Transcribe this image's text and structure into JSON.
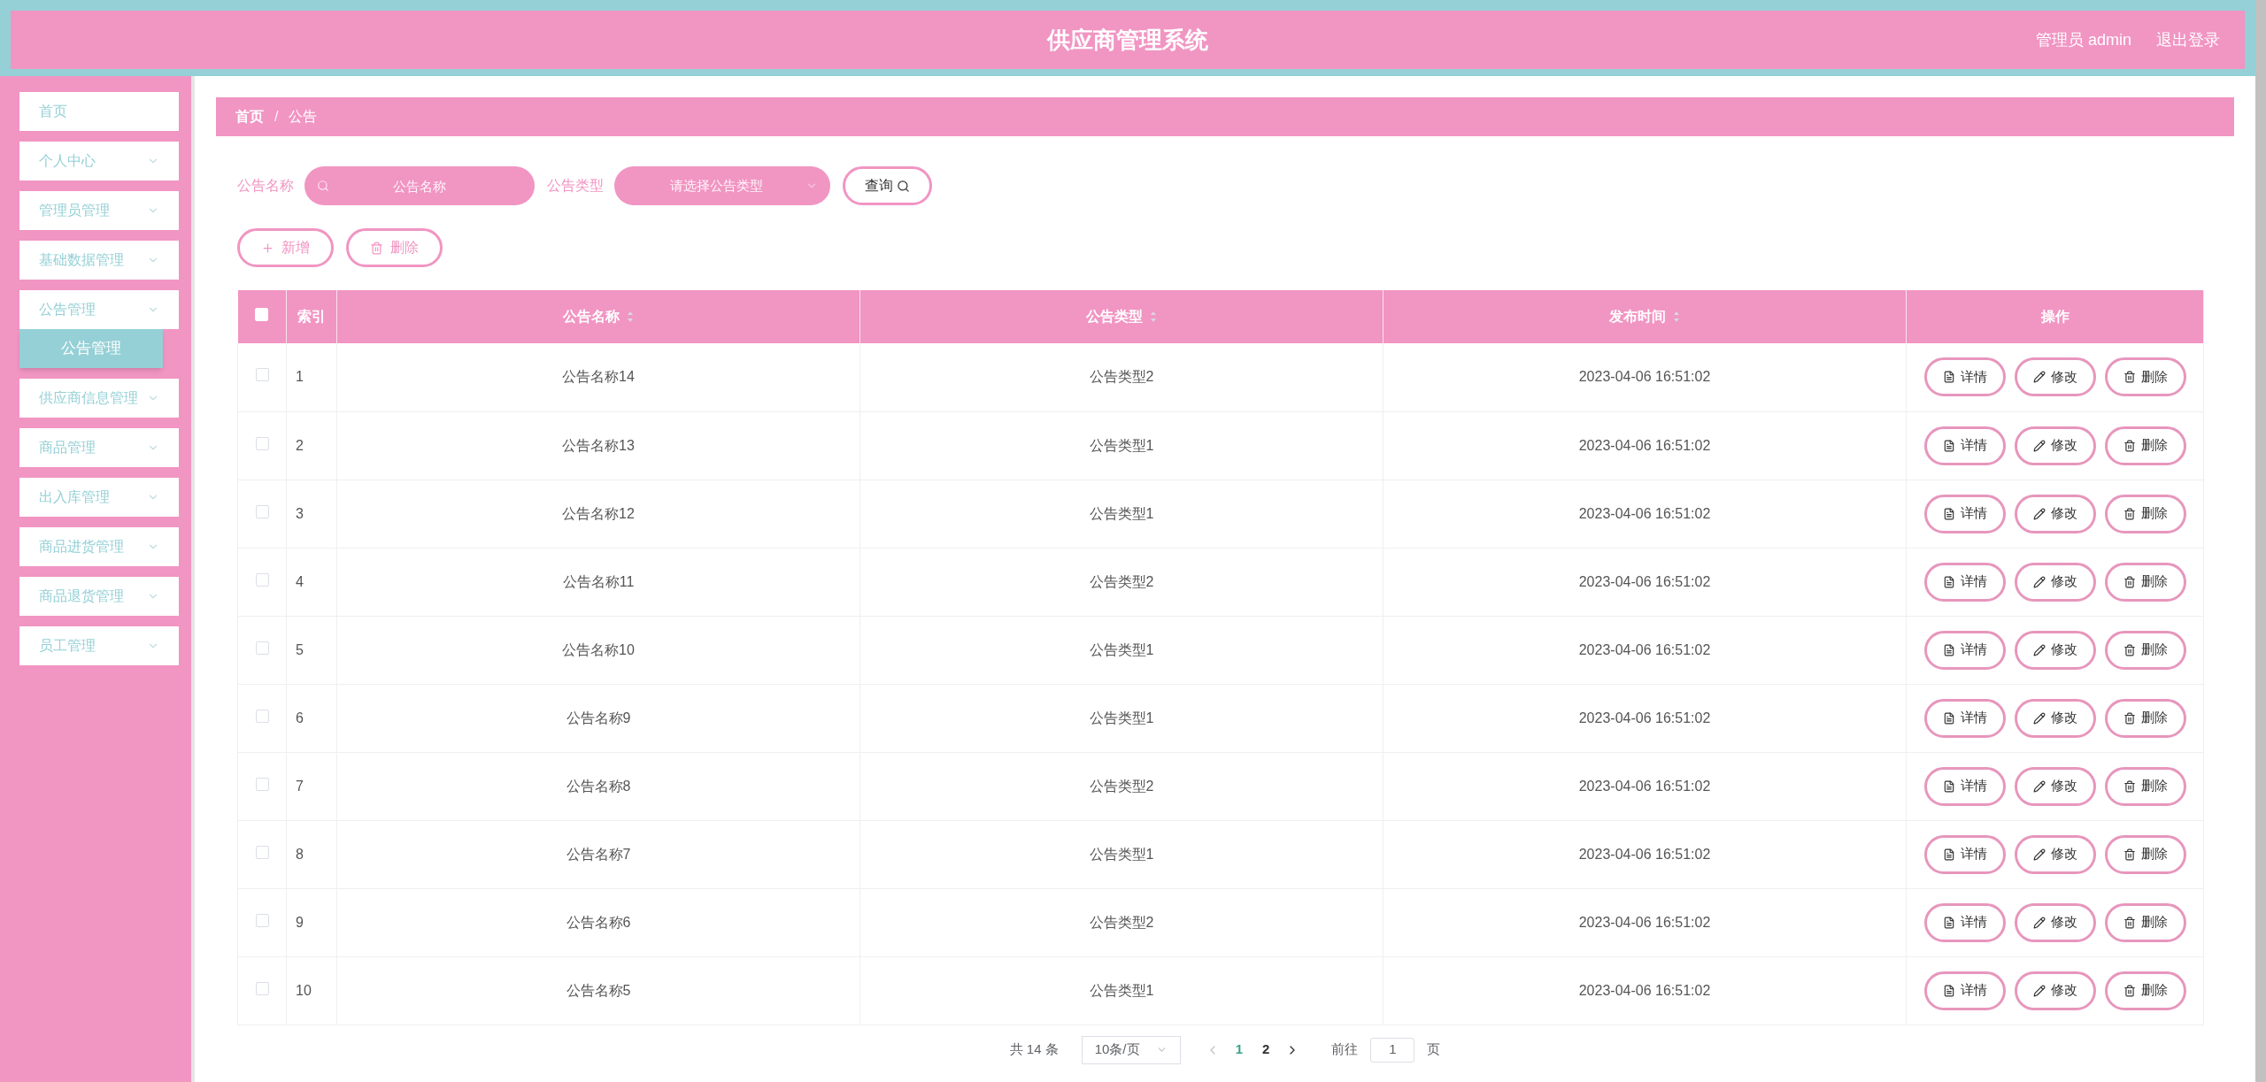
{
  "header": {
    "title": "供应商管理系统",
    "user": "管理员 admin",
    "logout": "退出登录"
  },
  "sidebar": {
    "items": [
      {
        "label": "首页",
        "has_arrow": false
      },
      {
        "label": "个人中心",
        "has_arrow": true
      },
      {
        "label": "管理员管理",
        "has_arrow": true
      },
      {
        "label": "基础数据管理",
        "has_arrow": true
      },
      {
        "label": "公告管理",
        "has_arrow": true,
        "children": [
          {
            "label": "公告管理",
            "selected": true
          }
        ]
      },
      {
        "label": "供应商信息管理",
        "has_arrow": true
      },
      {
        "label": "商品管理",
        "has_arrow": true
      },
      {
        "label": "出入库管理",
        "has_arrow": true
      },
      {
        "label": "商品进货管理",
        "has_arrow": true
      },
      {
        "label": "商品退货管理",
        "has_arrow": true
      },
      {
        "label": "员工管理",
        "has_arrow": true
      }
    ]
  },
  "breadcrumb": [
    {
      "label": "首页"
    },
    {
      "separator": "/",
      "label": "公告"
    }
  ],
  "search": {
    "name_label": "公告名称",
    "name_placeholder": "公告名称",
    "type_label": "公告类型",
    "type_placeholder": "请选择公告类型",
    "query_button": "查询"
  },
  "actions": [
    {
      "kind": "add",
      "label": "新增"
    },
    {
      "kind": "delete",
      "label": "删除"
    }
  ],
  "table": {
    "select_all_checked": false,
    "columns": [
      {
        "label": "索引",
        "sortable": false
      },
      {
        "label": "公告名称",
        "sortable": true
      },
      {
        "label": "公告类型",
        "sortable": true
      },
      {
        "label": "发布时间",
        "sortable": true
      },
      {
        "label": "操作",
        "sortable": false
      }
    ],
    "rows": [
      {
        "checked": false,
        "cells": [
          "1",
          "公告名称14",
          "公告类型2",
          "2023-04-06 16:51:02"
        ],
        "buttons": [
          {
            "kind": "detail",
            "label": "详情"
          },
          {
            "kind": "edit",
            "label": "修改"
          },
          {
            "kind": "delete",
            "label": "删除"
          }
        ]
      },
      {
        "checked": false,
        "cells": [
          "2",
          "公告名称13",
          "公告类型1",
          "2023-04-06 16:51:02"
        ],
        "buttons": [
          {
            "kind": "detail",
            "label": "详情"
          },
          {
            "kind": "edit",
            "label": "修改"
          },
          {
            "kind": "delete",
            "label": "删除"
          }
        ]
      },
      {
        "checked": false,
        "cells": [
          "3",
          "公告名称12",
          "公告类型1",
          "2023-04-06 16:51:02"
        ],
        "buttons": [
          {
            "kind": "detail",
            "label": "详情"
          },
          {
            "kind": "edit",
            "label": "修改"
          },
          {
            "kind": "delete",
            "label": "删除"
          }
        ]
      },
      {
        "checked": false,
        "cells": [
          "4",
          "公告名称11",
          "公告类型2",
          "2023-04-06 16:51:02"
        ],
        "buttons": [
          {
            "kind": "detail",
            "label": "详情"
          },
          {
            "kind": "edit",
            "label": "修改"
          },
          {
            "kind": "delete",
            "label": "删除"
          }
        ]
      },
      {
        "checked": false,
        "cells": [
          "5",
          "公告名称10",
          "公告类型1",
          "2023-04-06 16:51:02"
        ],
        "buttons": [
          {
            "kind": "detail",
            "label": "详情"
          },
          {
            "kind": "edit",
            "label": "修改"
          },
          {
            "kind": "delete",
            "label": "删除"
          }
        ]
      },
      {
        "checked": false,
        "cells": [
          "6",
          "公告名称9",
          "公告类型1",
          "2023-04-06 16:51:02"
        ],
        "buttons": [
          {
            "kind": "detail",
            "label": "详情"
          },
          {
            "kind": "edit",
            "label": "修改"
          },
          {
            "kind": "delete",
            "label": "删除"
          }
        ]
      },
      {
        "checked": false,
        "cells": [
          "7",
          "公告名称8",
          "公告类型2",
          "2023-04-06 16:51:02"
        ],
        "buttons": [
          {
            "kind": "detail",
            "label": "详情"
          },
          {
            "kind": "edit",
            "label": "修改"
          },
          {
            "kind": "delete",
            "label": "删除"
          }
        ]
      },
      {
        "checked": false,
        "cells": [
          "8",
          "公告名称7",
          "公告类型1",
          "2023-04-06 16:51:02"
        ],
        "buttons": [
          {
            "kind": "detail",
            "label": "详情"
          },
          {
            "kind": "edit",
            "label": "修改"
          },
          {
            "kind": "delete",
            "label": "删除"
          }
        ]
      },
      {
        "checked": false,
        "cells": [
          "9",
          "公告名称6",
          "公告类型2",
          "2023-04-06 16:51:02"
        ],
        "buttons": [
          {
            "kind": "detail",
            "label": "详情"
          },
          {
            "kind": "edit",
            "label": "修改"
          },
          {
            "kind": "delete",
            "label": "删除"
          }
        ]
      },
      {
        "checked": false,
        "cells": [
          "10",
          "公告名称5",
          "公告类型1",
          "2023-04-06 16:51:02"
        ],
        "buttons": [
          {
            "kind": "detail",
            "label": "详情"
          },
          {
            "kind": "edit",
            "label": "修改"
          },
          {
            "kind": "delete",
            "label": "删除"
          }
        ]
      }
    ]
  },
  "pagination": {
    "total": "共 14 条",
    "page_size": "10条/页",
    "pages": [
      {
        "label": "1",
        "selected": true
      },
      {
        "label": "2",
        "selected": false
      }
    ],
    "goto_label": "前往",
    "goto_value": "1",
    "goto_suffix": "页"
  }
}
